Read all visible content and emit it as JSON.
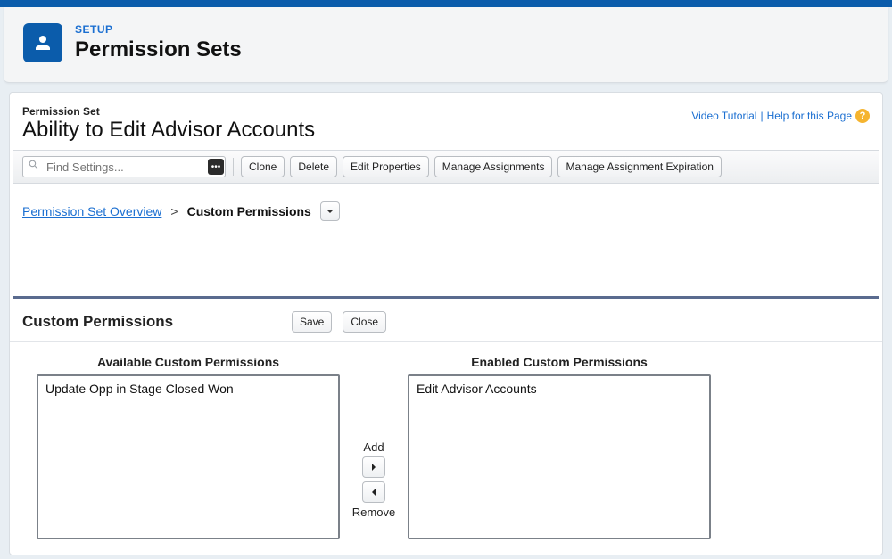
{
  "header": {
    "eyebrow": "SETUP",
    "title": "Permission Sets"
  },
  "page": {
    "crumb_label": "Permission Set",
    "title": "Ability to Edit Advisor Accounts"
  },
  "help": {
    "video_label": "Video Tutorial",
    "separator": "|",
    "help_label": "Help for this Page"
  },
  "search": {
    "placeholder": "Find Settings..."
  },
  "toolbar": {
    "clone": "Clone",
    "delete": "Delete",
    "edit_properties": "Edit Properties",
    "manage_assignments": "Manage Assignments",
    "manage_expiration": "Manage Assignment Expiration"
  },
  "breadcrumb": {
    "overview": "Permission Set Overview",
    "sep": ">",
    "current": "Custom Permissions"
  },
  "section": {
    "title": "Custom Permissions",
    "save": "Save",
    "close": "Close"
  },
  "picklists": {
    "available_label": "Available Custom Permissions",
    "enabled_label": "Enabled Custom Permissions",
    "available": [
      "Update Opp in Stage Closed Won"
    ],
    "enabled": [
      "Edit Advisor Accounts"
    ]
  },
  "mover": {
    "add": "Add",
    "remove": "Remove"
  }
}
